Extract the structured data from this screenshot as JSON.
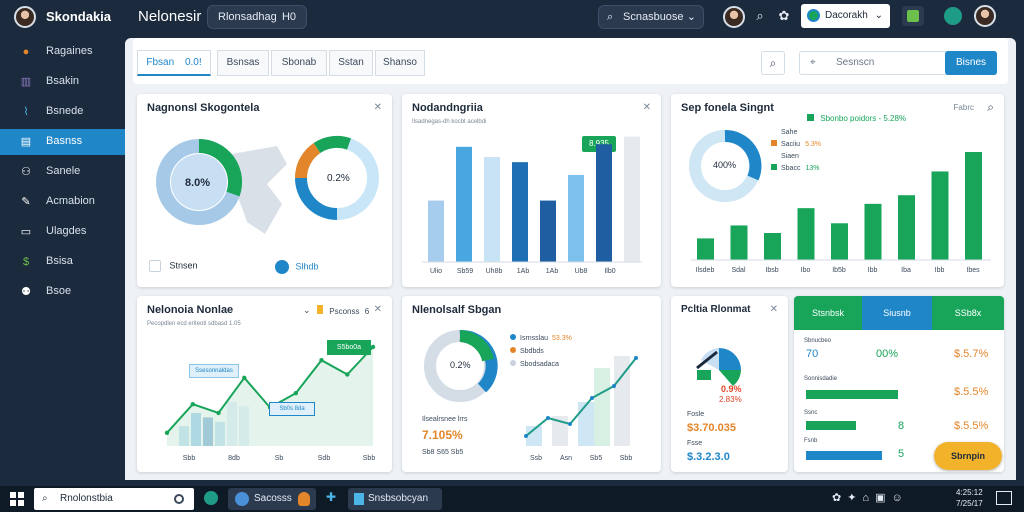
{
  "app": {
    "title": "Skondakia",
    "workspace": "Nelonesir"
  },
  "header": {
    "search_chip": "Rlonsadhag",
    "search_chip_suffix": "H0",
    "region_select": "Scnasbuose",
    "account_select": "Dacorakh"
  },
  "sidebar": {
    "items": [
      {
        "label": "Ragaines",
        "icon": "avatar-icon"
      },
      {
        "label": "Bsakin",
        "icon": "chart-icon"
      },
      {
        "label": "Bsnede",
        "icon": "analytics-icon"
      },
      {
        "label": "Basnss",
        "icon": "table-icon",
        "active": true
      },
      {
        "label": "Sanele",
        "icon": "nodes-icon"
      },
      {
        "label": "Acmabion",
        "icon": "wrench-icon"
      },
      {
        "label": "Ulagdes",
        "icon": "document-icon"
      },
      {
        "label": "Bsisa",
        "icon": "coin-icon"
      },
      {
        "label": "Bsoe",
        "icon": "group-icon"
      }
    ]
  },
  "toolbar": {
    "tabs": [
      {
        "label": "Fbsan",
        "badge": "0.0!",
        "active": true
      },
      {
        "label": "Bsnsas"
      },
      {
        "label": "Sbonab"
      },
      {
        "label": "Sstan"
      },
      {
        "label": "Shanso"
      }
    ],
    "search_placeholder": "Sesnscn",
    "search_button": "Bisnes"
  },
  "cards": {
    "regional": {
      "title": "Nagnonsl Skogontela",
      "map_value": "8.0%",
      "donut_value": "0.2%",
      "legend_a": "Stnsen",
      "legend_b": "Slhdb"
    },
    "bar_overview": {
      "title": "Nodandngriia",
      "subtitle": "Ilsadnegas-dh kocbt acelbdi",
      "callout": "8.935",
      "x_labels": [
        "Ulio",
        "Sb59",
        "Uh8b",
        "1Ab",
        "1Ab",
        "Ub8",
        "Ilb0"
      ],
      "values": [
        48,
        90,
        82,
        78,
        48,
        68,
        92,
        98
      ]
    },
    "sep_signal": {
      "title": "Sep fonela Singnt",
      "menu": "Fabrc",
      "kpi": "Sbonbo poidors - 5.28%",
      "donut_value": "400%",
      "legend": [
        {
          "label": "Sahe"
        },
        {
          "label": "Saciiu",
          "value": "5.3%",
          "color": "#e3852b"
        },
        {
          "label": "Siaen"
        },
        {
          "label": "Sbacc",
          "value": "13%",
          "color": "#18a55a"
        }
      ],
      "x_labels": [
        "Ilsdeb",
        "Sdal",
        "Ibsb",
        "Ibo",
        "Ib5b",
        "Ibb",
        "Iba",
        "Ibb",
        "Ibes"
      ],
      "values": [
        20,
        32,
        25,
        48,
        34,
        52,
        60,
        82,
        100
      ]
    },
    "trend": {
      "title": "Nelonoia Nonlae",
      "subtitle": "Pecopdlen ecd eriteoti sdbasd 1.05",
      "legend_value": "Psconss",
      "legend_tag": "6",
      "tooltip_a": "Ssesonnaldas",
      "tooltip_b": "Sb0s 8da",
      "tooltip_c": "S5bo0a",
      "x_labels": [
        "Sbb",
        "8db",
        "Sb",
        "Sdb",
        "Sbb"
      ],
      "line": [
        12,
        38,
        30,
        62,
        35,
        48,
        78,
        65,
        90
      ],
      "bars": [
        18,
        30,
        26,
        22,
        40,
        36
      ]
    },
    "segments": {
      "title": "Nlenolsalf Sbgan",
      "donut_value": "0.2%",
      "legend": [
        {
          "label": "Isrnsslau",
          "value": "53.3%",
          "color": "#1f86c8"
        },
        {
          "label": "Sbdbds",
          "value": "",
          "color": "#e3852b"
        },
        {
          "label": "Sbodsadaca",
          "value": "",
          "color": "#c9d2dc"
        }
      ],
      "label_a": "Ilsealrsnee lrrs",
      "value_a": "7.105%",
      "label_b": "Sb8 S65 Sb5",
      "x_labels": [
        "Ssb",
        "Asn",
        "Sb5",
        "Sbb"
      ],
      "line": [
        10,
        28,
        22,
        48,
        60,
        88
      ]
    },
    "potential": {
      "title": "Pcltia Rlonmat",
      "gauge_value": "0.9%",
      "gauge_sub": "2.83%",
      "label_a": "Fosle",
      "value_a": "$3.70.035",
      "label_b": "Fsse",
      "value_b": "$.3.2.3.0"
    },
    "stats": {
      "tabs": [
        "Stsnbsk",
        "Siusnb",
        "SSb8x"
      ],
      "rows": [
        {
          "label": "Sbnucbeo",
          "a": "70",
          "b": "00%",
          "c": "$.5.7%"
        },
        {
          "label": "Sonnisdadie",
          "a": "",
          "b": "",
          "c": "$.5.5%"
        },
        {
          "label": "Ssnc",
          "a": "",
          "b": "8",
          "c": "$.5.5%"
        },
        {
          "label": "Fsnb",
          "a": "",
          "b": "5",
          "c": ""
        }
      ],
      "bars": [
        0.82,
        0.45,
        0.68
      ],
      "button": "Sbrnpin"
    }
  },
  "taskbar": {
    "search": "Rnolonstbia",
    "apps": [
      "Sacosss",
      "Snsbsobcyan"
    ],
    "time": "4:25:12",
    "date": "7/25/17"
  },
  "colors": {
    "accent": "#1f86c8",
    "green": "#18a55a",
    "navy": "#1c2a3d",
    "orange": "#e3852b"
  }
}
